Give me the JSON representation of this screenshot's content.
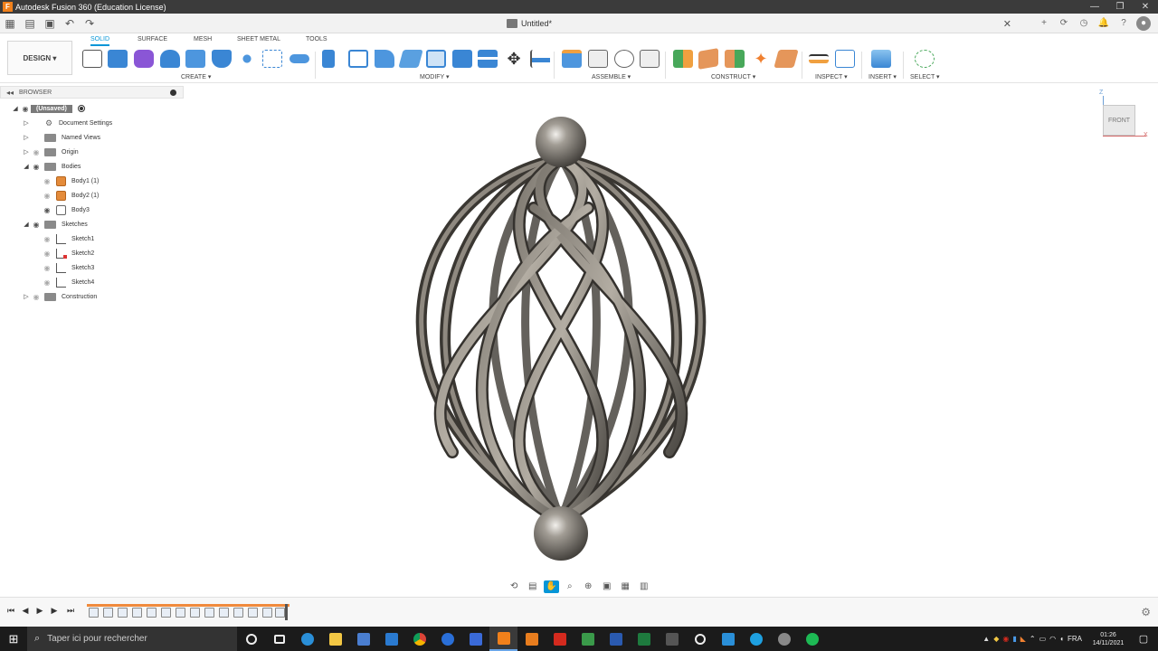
{
  "window": {
    "title": "Autodesk Fusion 360 (Education License)",
    "app_icon": "F",
    "minimize": "—",
    "maximize": "❐",
    "close": "✕"
  },
  "document": {
    "name": "Untitled*",
    "close": "✕"
  },
  "workspace": {
    "label": "DESIGN ▾"
  },
  "ribbon": {
    "tabs": [
      "SOLID",
      "SURFACE",
      "MESH",
      "SHEET METAL",
      "TOOLS"
    ],
    "active_tab": "SOLID",
    "groups": [
      "CREATE ▾",
      "MODIFY ▾",
      "ASSEMBLE ▾",
      "CONSTRUCT ▾",
      "INSPECT ▾",
      "INSERT ▾",
      "SELECT ▾"
    ]
  },
  "browser": {
    "title": "BROWSER",
    "collapse_icon": "◂◂",
    "root": "(Unsaved)",
    "items": [
      {
        "label": "Document Settings",
        "type": "gear"
      },
      {
        "label": "Named Views",
        "type": "folder"
      },
      {
        "label": "Origin",
        "type": "folder"
      },
      {
        "label": "Bodies",
        "type": "folder"
      },
      {
        "label": "Body1 (1)",
        "type": "body"
      },
      {
        "label": "Body2 (1)",
        "type": "body"
      },
      {
        "label": "Body3",
        "type": "body-plain"
      },
      {
        "label": "Sketches",
        "type": "folder"
      },
      {
        "label": "Sketch1",
        "type": "sketch"
      },
      {
        "label": "Sketch2",
        "type": "sketch-red"
      },
      {
        "label": "Sketch3",
        "type": "sketch"
      },
      {
        "label": "Sketch4",
        "type": "sketch"
      },
      {
        "label": "Construction",
        "type": "folder"
      }
    ]
  },
  "viewcube": {
    "face": "FRONT",
    "z": "Z",
    "x": "X"
  },
  "taskbar": {
    "search_placeholder": "Taper ici pour rechercher",
    "lang": "FRA",
    "time": "01:26",
    "date": "14/11/2021"
  },
  "colors": {
    "accent": "#0696d7",
    "timeline": "#f08a3c",
    "model_metal": "#5a5651",
    "model_highlight": "#9a948b"
  }
}
